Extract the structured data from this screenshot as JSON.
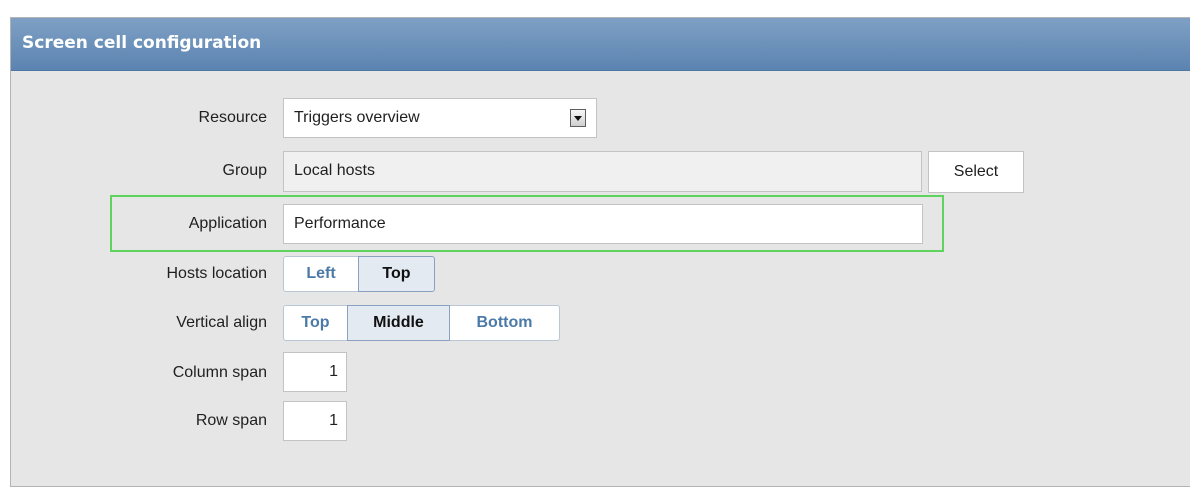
{
  "panel": {
    "title": "Screen cell configuration"
  },
  "form": {
    "resource": {
      "label": "Resource",
      "value": "Triggers overview"
    },
    "group": {
      "label": "Group",
      "value": "Local hosts",
      "select_label": "Select"
    },
    "application": {
      "label": "Application",
      "value": "Performance"
    },
    "hosts_location": {
      "label": "Hosts location",
      "options": [
        "Left",
        "Top"
      ],
      "selected": "Top"
    },
    "vertical_align": {
      "label": "Vertical align",
      "options": [
        "Top",
        "Middle",
        "Bottom"
      ],
      "selected": "Middle"
    },
    "column_span": {
      "label": "Column span",
      "value": "1"
    },
    "row_span": {
      "label": "Row span",
      "value": "1"
    }
  },
  "colors": {
    "header": "#6e93bb",
    "highlight": "#5ed35e",
    "radio_text": "#4b7aa8"
  }
}
